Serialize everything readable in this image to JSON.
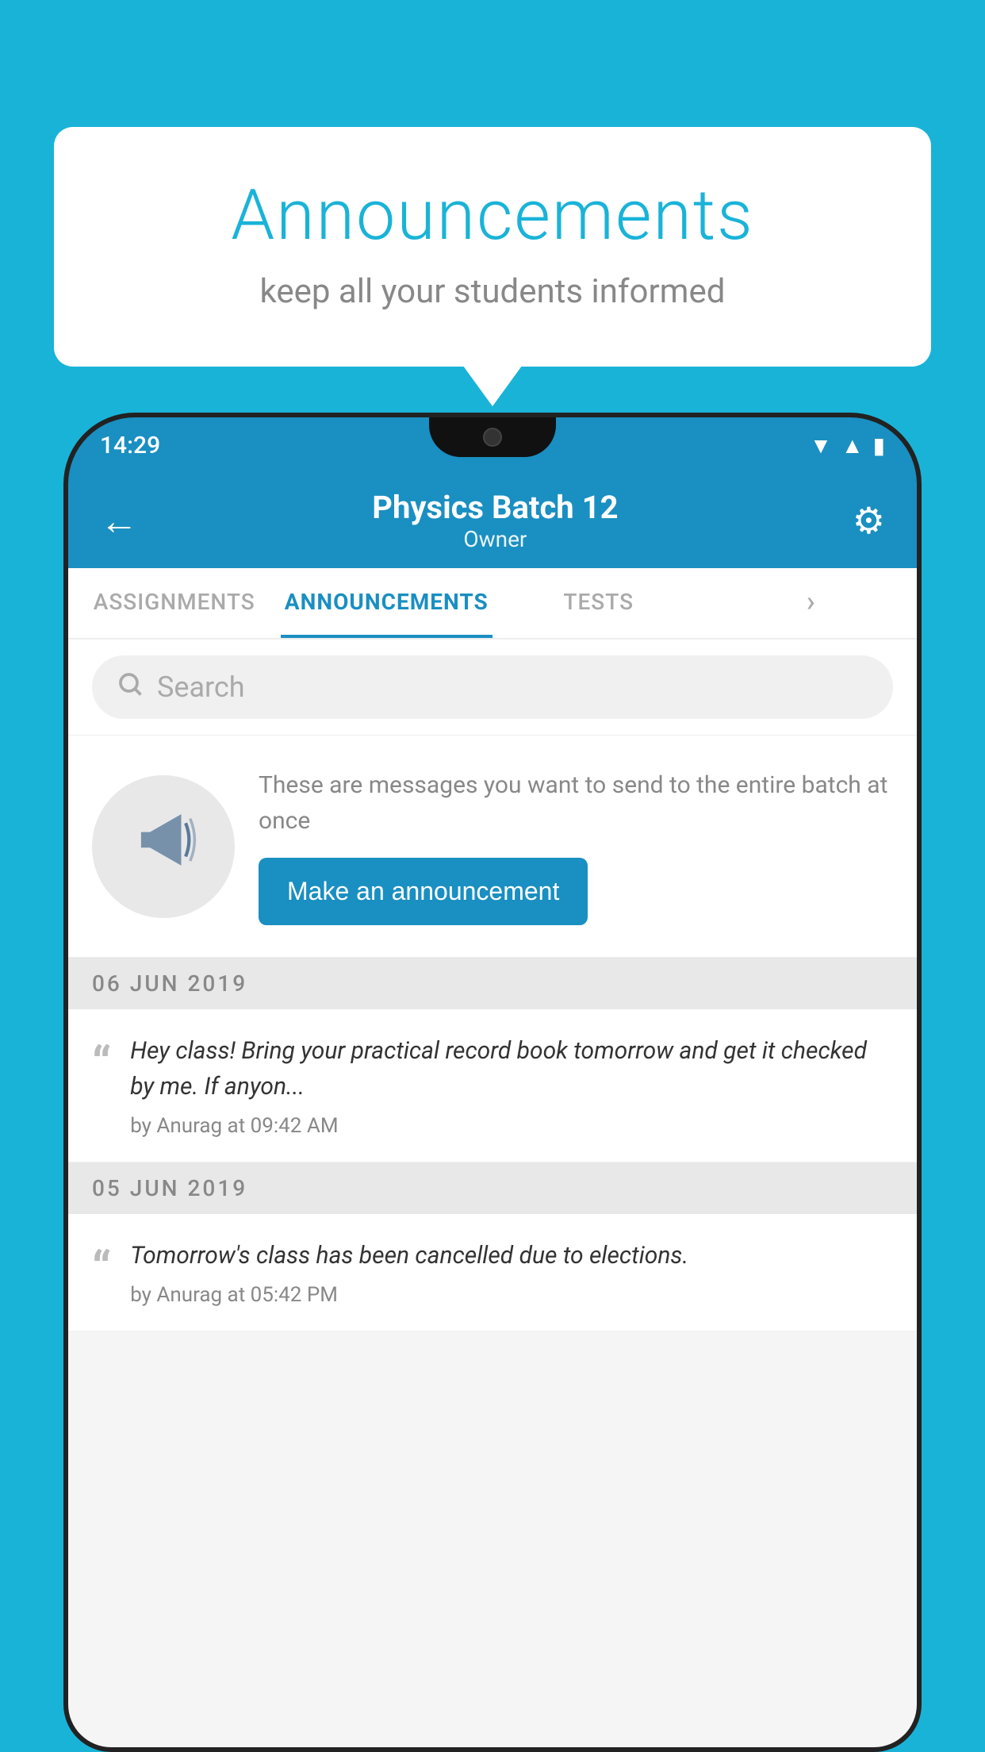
{
  "background_color": "#1ab3d8",
  "speech_bubble": {
    "title": "Announcements",
    "subtitle": "keep all your students informed"
  },
  "status_bar": {
    "time": "14:29",
    "icons": [
      "wifi",
      "signal",
      "battery"
    ]
  },
  "header": {
    "title": "Physics Batch 12",
    "subtitle": "Owner",
    "back_label": "←",
    "settings_label": "⚙"
  },
  "tabs": [
    {
      "label": "ASSIGNMENTS",
      "active": false
    },
    {
      "label": "ANNOUNCEMENTS",
      "active": true
    },
    {
      "label": "TESTS",
      "active": false
    },
    {
      "label": "···",
      "active": false
    }
  ],
  "search": {
    "placeholder": "Search"
  },
  "cta": {
    "description": "These are messages you want to send to the entire batch at once",
    "button_label": "Make an announcement"
  },
  "announcement_groups": [
    {
      "date": "06  JUN  2019",
      "items": [
        {
          "message": "Hey class! Bring your practical record book tomorrow and get it checked by me. If anyon...",
          "author": "by Anurag at 09:42 AM"
        }
      ]
    },
    {
      "date": "05  JUN  2019",
      "items": [
        {
          "message": "Tomorrow's class has been cancelled due to elections.",
          "author": "by Anurag at 05:42 PM"
        }
      ]
    }
  ]
}
